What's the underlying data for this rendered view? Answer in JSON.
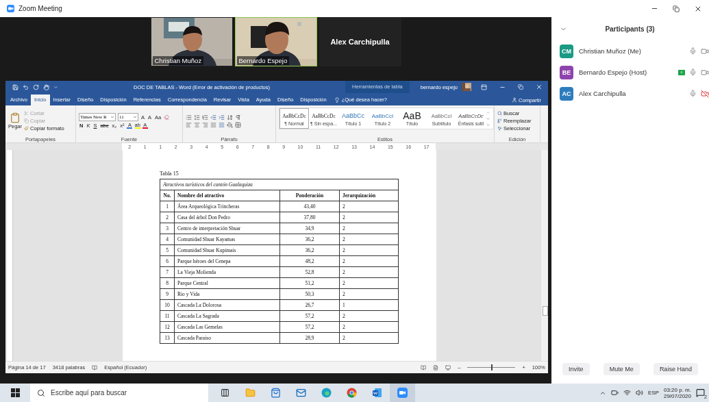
{
  "window": {
    "title": "Zoom Meeting"
  },
  "videos": [
    {
      "kind": "picture",
      "name": "Christian Muñoz",
      "active": false
    },
    {
      "kind": "picture",
      "name": "Bernardo Espejo",
      "active": true
    },
    {
      "kind": "name",
      "name": "Alex Carchipulla",
      "active": false
    }
  ],
  "word": {
    "title": "DOC DE TABLAS  -  Word (Error de activación de productos)",
    "context_tab": "Herramientas de tabla",
    "user": "bernardo espejo",
    "tabs": [
      {
        "label": "Archivo",
        "selected": false
      },
      {
        "label": "Inicio",
        "selected": true
      },
      {
        "label": "Insertar",
        "selected": false
      },
      {
        "label": "Diseño",
        "selected": false
      },
      {
        "label": "Disposición",
        "selected": false
      },
      {
        "label": "Referencias",
        "selected": false
      },
      {
        "label": "Correspondencia",
        "selected": false
      },
      {
        "label": "Revisar",
        "selected": false
      },
      {
        "label": "Vista",
        "selected": false
      },
      {
        "label": "Ayuda",
        "selected": false
      },
      {
        "label": "Diseño",
        "selected": false
      },
      {
        "label": "Disposición",
        "selected": false
      }
    ],
    "tell_me": "¿Qué desea hacer?",
    "share": "Compartir",
    "groups": [
      "Portapapeles",
      "Fuente",
      "Párrafo",
      "Estilos",
      "Edición"
    ],
    "clipboard": {
      "paste": "Pegar",
      "items": [
        {
          "label": "Cortar",
          "disabled": true
        },
        {
          "label": "Copiar",
          "disabled": true
        },
        {
          "label": "Copiar formato",
          "disabled": false
        }
      ]
    },
    "font": {
      "name": "Times New R",
      "size": "11",
      "size_buttons": [
        "A",
        "A"
      ],
      "case_button": "Aa",
      "format_buttons": [
        "N",
        "K",
        "S",
        "abc",
        "x₂",
        "x²"
      ],
      "color_buttons": [
        {
          "label": "A",
          "color": "#2e75d6"
        },
        {
          "label": "ab",
          "color": "#f5f500"
        },
        {
          "label": "A",
          "color": "#e81123"
        }
      ]
    },
    "styles": [
      {
        "kind": "normal",
        "preview": "AaBbCcDc",
        "name": "¶ Normal",
        "selected": true
      },
      {
        "kind": "normal",
        "preview": "AaBbCcDc",
        "name": "¶ Sin espa...",
        "selected": false
      },
      {
        "kind": "heading1",
        "preview": "AaBbCc",
        "name": "Título 1",
        "selected": false
      },
      {
        "kind": "heading2",
        "preview": "AaBbCcI",
        "name": "Título 2",
        "selected": false
      },
      {
        "kind": "title",
        "preview": "AaB",
        "name": "Título",
        "selected": false
      },
      {
        "kind": "subtitle",
        "preview": "AaBbCcI",
        "name": "Subtítulo",
        "selected": false
      },
      {
        "kind": "emphasis",
        "preview": "AaBbCcDc",
        "name": "Énfasis sutil",
        "selected": false
      }
    ],
    "editing": [
      "Buscar",
      "Reemplazar",
      "Seleccionar"
    ],
    "ruler_marks": [
      "2",
      "1",
      "1",
      "2",
      "3",
      "4",
      "5",
      "6",
      "7",
      "8",
      "9",
      "10",
      "11",
      "12",
      "13",
      "14",
      "15",
      "16",
      "17"
    ],
    "document": {
      "caption": "Tabla 15",
      "table": {
        "title": "Atractivos turísticos del cantón Gualaquiza",
        "columns": [
          "No.",
          "Nombre del atractivo",
          "Ponderación",
          "Jerarquización"
        ],
        "rows": [
          [
            "1",
            "Área Arqueológica Trincheras",
            "43,40",
            "2"
          ],
          [
            "2",
            "Casa del árbol Don Pedro",
            "37,80",
            "2"
          ],
          [
            "3",
            "Centro de interpretación Shuar",
            "34,9",
            "2"
          ],
          [
            "4",
            "Comunidad Shuar Kayamas",
            "36,2",
            "2"
          ],
          [
            "5",
            "Comunidad Shuar Kupimais",
            "36,2",
            "2"
          ],
          [
            "6",
            "Parque héroes del Cenepa",
            "48,2",
            "2"
          ],
          [
            "7",
            "La Vieja Molienda",
            "52,8",
            "2"
          ],
          [
            "8",
            "Parque Central",
            "51,2",
            "2"
          ],
          [
            "9",
            "Rio y Vida",
            "50,3",
            "2"
          ],
          [
            "10",
            "Cascada La Dolorosa",
            "26,7",
            "1"
          ],
          [
            "11",
            "Cascada La Sagrada",
            "57,2",
            "2"
          ],
          [
            "12",
            "Cascada Las Gemelas",
            "57,2",
            "2"
          ],
          [
            "13",
            "Cascada Paraiso",
            "28,9",
            "2"
          ]
        ]
      }
    },
    "status": {
      "page": "Página 14 de 17",
      "words": "3418 palabras",
      "language": "Español (Ecuador)",
      "zoom_minus": "–",
      "zoom_plus": "+",
      "zoom": "100%",
      "level": 0.5
    }
  },
  "participants": {
    "title": "Participants (3)",
    "items": [
      {
        "initials": "CM",
        "name": "Christian Muñoz (Me)",
        "color": "#1a9a84",
        "sharing": false,
        "video_on": true
      },
      {
        "initials": "BE",
        "name": "Bernardo Espejo (Host)",
        "color": "#8e44ad",
        "sharing": true,
        "video_on": true
      },
      {
        "initials": "AC",
        "name": "Alex Carchipulla",
        "color": "#2d7dbd",
        "sharing": false,
        "video_on": false
      }
    ]
  },
  "controls": [
    "Invite",
    "Mute Me",
    "Raise Hand"
  ],
  "taskbar": {
    "search_placeholder": "Escribe aquí para buscar",
    "language": "ESP",
    "time": "03:20 p. m.",
    "date": "29/07/2020",
    "notifications": "2"
  }
}
